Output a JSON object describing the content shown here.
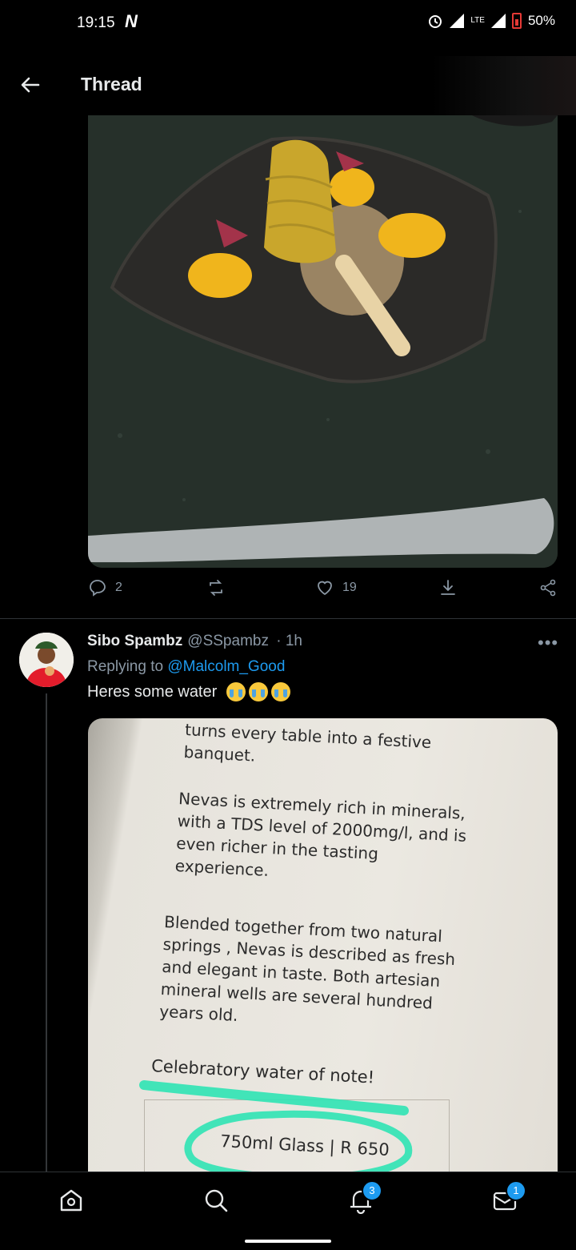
{
  "status_bar": {
    "time": "19:15",
    "carrier_logo": "N",
    "network": "LTE",
    "battery": "50%"
  },
  "header": {
    "title": "Thread"
  },
  "first_tweet_actions": {
    "replies": "2",
    "retweets": "",
    "likes": "19"
  },
  "reply_tweet": {
    "name": "Sibo Spambz",
    "handle": "@SSpambz",
    "time": "· 1h",
    "replying_prefix": "Replying to",
    "replying_to": "@Malcolm_Good",
    "text": "Heres some water"
  },
  "menu_photo": {
    "line_top": "turns every table into a festive\nbanquet.",
    "para1": "Nevas is extremely rich in minerals,\nwith a TDS level of 2000mg/l, and is\neven richer in the tasting\nexperience.",
    "para2": "Blended together from two natural\nsprings , Nevas is described as fresh\nand elegant in taste. Both artesian\nmineral wells are several hundred\nyears old.",
    "note": "Celebratory water of note!",
    "price": "750ml Glass | R 650"
  },
  "bottom_nav": {
    "notifications_badge": "3",
    "messages_badge": "1"
  },
  "colors": {
    "accent": "#1d9bf0",
    "background": "#000000",
    "muted": "#8b98a5",
    "highlighter": "#2fe3b4"
  }
}
